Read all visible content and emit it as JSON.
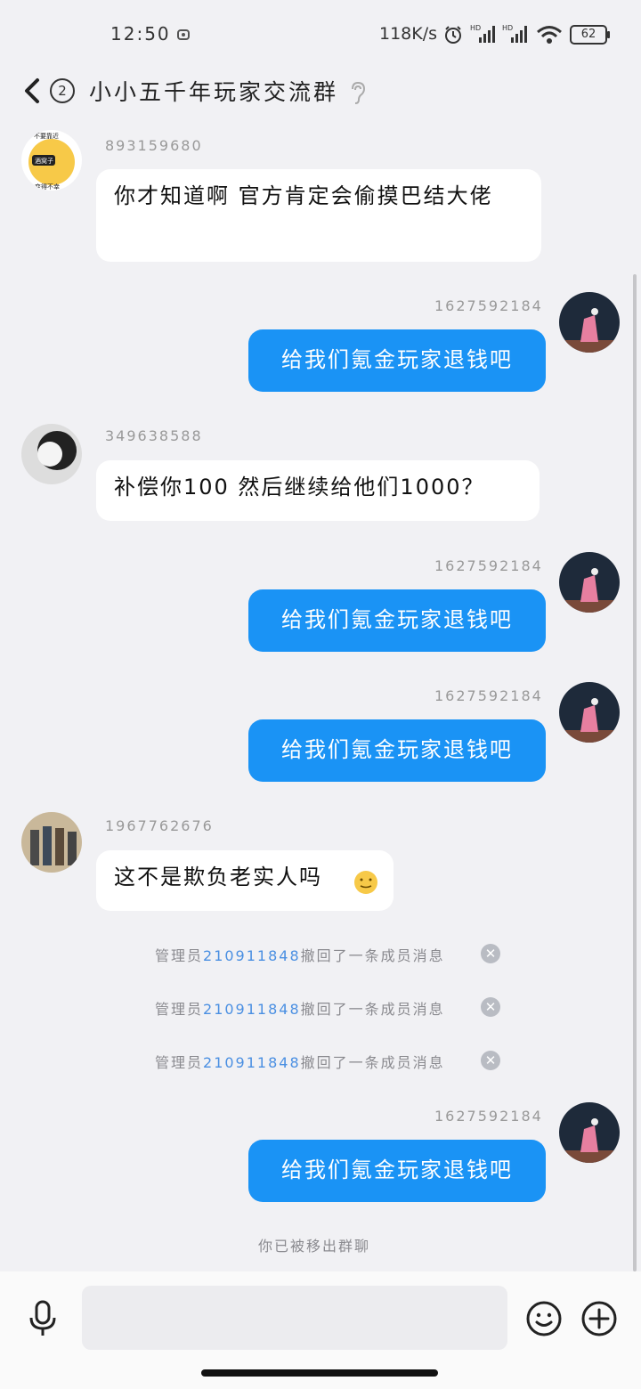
{
  "status_bar": {
    "time": "12:50",
    "net_speed": "118K/s",
    "battery": "62"
  },
  "header": {
    "unread_count": "2",
    "title": "小小五千年玩家交流群"
  },
  "messages": [
    {
      "sender": "893159680",
      "text": "你才知道啊 官方肯定会偷摸巴结大佬",
      "avatar_text_top": "不要靠近",
      "avatar_text_mid": "酒窝子",
      "avatar_text_bot": "会变得不幸"
    },
    {
      "sender": "1627592184",
      "text": "给我们氪金玩家退钱吧"
    },
    {
      "sender": "349638588",
      "text": "补偿你100  然后继续给他们1000？"
    },
    {
      "sender": "1627592184",
      "text": "给我们氪金玩家退钱吧"
    },
    {
      "sender": "1627592184",
      "text": "给我们氪金玩家退钱吧"
    },
    {
      "sender": "1967762676",
      "text": "这不是欺负老实人吗"
    },
    {
      "sender": "1627592184",
      "text": "给我们氪金玩家退钱吧"
    }
  ],
  "system_notices": [
    {
      "prefix": "管理员",
      "uid": "210911848",
      "suffix": "撤回了一条成员消息"
    },
    {
      "prefix": "管理员",
      "uid": "210911848",
      "suffix": "撤回了一条成员消息"
    },
    {
      "prefix": "管理员",
      "uid": "210911848",
      "suffix": "撤回了一条成员消息"
    }
  ],
  "removed_notice": "你已被移出群聊",
  "icons": [
    "back-icon",
    "ear-icon",
    "mic-icon",
    "emoji-icon",
    "plus-icon",
    "close-icon"
  ],
  "colors": {
    "bubble_out": "#1a93f5",
    "uid_link": "#4a8fe2",
    "background": "#f1f1f4"
  }
}
